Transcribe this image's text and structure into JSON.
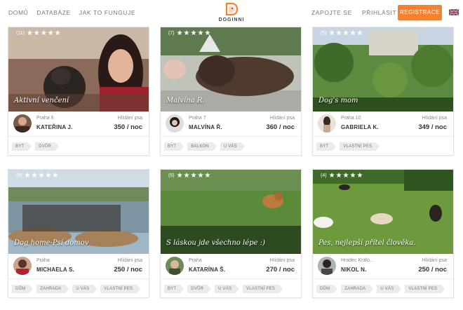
{
  "nav": {
    "left": [
      "DOMŮ",
      "DATABÁZE",
      "JAK TO FUNGUJE"
    ],
    "right": [
      "ZAPOJTE SE",
      "PŘIHLÁSIT SE"
    ],
    "register": "REGISTRACE",
    "logo_text": "DOGINNI",
    "language_flag": "uk-flag-icon",
    "accent_color": "#f3812f"
  },
  "cards": [
    {
      "rating": "(11)",
      "stars": "★★★★★",
      "caption": "Aktivní venčení",
      "city": "Praha 6",
      "owner": "KATEŘINA J.",
      "price_type": "Hlídání psa",
      "price": "350 / noc",
      "tags": [
        "BYT",
        "DVŮR"
      ]
    },
    {
      "rating": "(7)",
      "stars": "★★★★★",
      "caption": "Malvína R.",
      "city": "Praha 7",
      "owner": "MALVÍNA Ř.",
      "price_type": "Hlídání psa",
      "price": "360 / noc",
      "tags": [
        "BYT",
        "BALKON",
        "U VÁS"
      ]
    },
    {
      "rating": "(5)",
      "stars": "★★★★★",
      "caption": "Dog's mom",
      "city": "Praha 10",
      "owner": "GABRIELA K.",
      "price_type": "Hlídání psa",
      "price": "349 / noc",
      "tags": [
        "BYT",
        "VLASTNÍ PES"
      ]
    },
    {
      "rating": "(5)",
      "stars": "★★★★★",
      "caption": "Dog home-Psí domov",
      "city": "Praha",
      "owner": "MICHAELA S.",
      "price_type": "Hlídání psa",
      "price": "250 / noc",
      "tags": [
        "DŮM",
        "ZAHRADA",
        "U VÁS",
        "VLASTNÍ PES"
      ]
    },
    {
      "rating": "(5)",
      "stars": "★★★★★",
      "caption": "S láskou jde všechno lépe :)",
      "city": "Praha",
      "owner": "KATARÍNA Š.",
      "price_type": "Hlídání psa",
      "price": "270 / noc",
      "tags": [
        "BYT",
        "DVŮR",
        "U VÁS",
        "VLASTNÍ PES"
      ]
    },
    {
      "rating": "(4)",
      "stars": "★★★★★",
      "caption": "Pes, nejlepší přítel člověka.",
      "city": "Hradec Králo...",
      "owner": "NIKOL N.",
      "price_type": "Hlídání psa",
      "price": "250 / noc",
      "tags": [
        "DŮM",
        "ZAHRADA",
        "U VÁS",
        "VLASTNÍ PES"
      ]
    }
  ]
}
